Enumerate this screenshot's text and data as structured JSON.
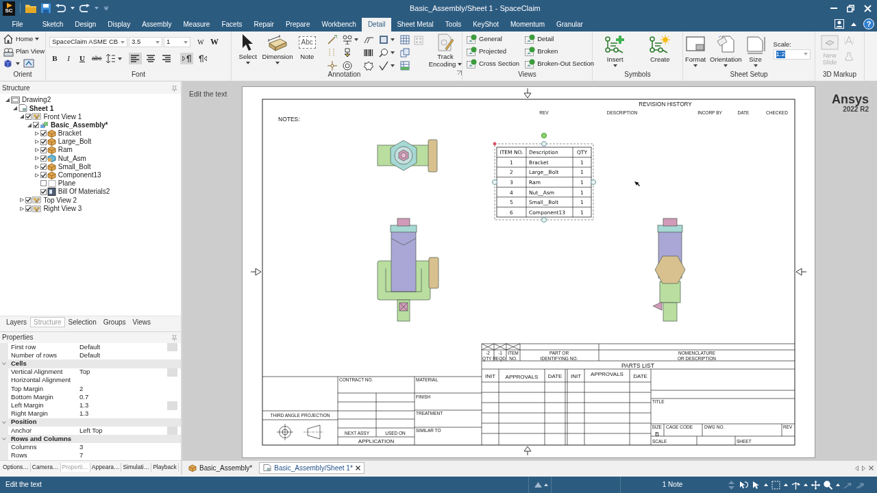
{
  "window": {
    "title": "Basic_Assembly/Sheet 1 - SpaceClaim",
    "logo_text": "SC"
  },
  "ribbon_tabs": [
    {
      "label": "File",
      "selected": false
    },
    {
      "label": "Sketch",
      "selected": false
    },
    {
      "label": "Design",
      "selected": false
    },
    {
      "label": "Display",
      "selected": false
    },
    {
      "label": "Assembly",
      "selected": false
    },
    {
      "label": "Measure",
      "selected": false
    },
    {
      "label": "Facets",
      "selected": false
    },
    {
      "label": "Repair",
      "selected": false
    },
    {
      "label": "Prepare",
      "selected": false
    },
    {
      "label": "Workbench",
      "selected": false
    },
    {
      "label": "Detail",
      "selected": true
    },
    {
      "label": "Sheet Metal",
      "selected": false
    },
    {
      "label": "Tools",
      "selected": false
    },
    {
      "label": "KeyShot",
      "selected": false
    },
    {
      "label": "Momentum",
      "selected": false
    },
    {
      "label": "Granular",
      "selected": false
    }
  ],
  "help_label": "?",
  "ribbon": {
    "orient": {
      "label": "Orient",
      "items": [
        {
          "kind": "home",
          "label": "Home"
        },
        {
          "kind": "plan",
          "label": "Plan View"
        }
      ]
    },
    "font": {
      "label": "Font",
      "font_name": "SpaceClaim ASME CB",
      "size": "3.5",
      "field_3": "1",
      "width_buttons": [
        {
          "kind": "normal",
          "label": "W"
        },
        {
          "kind": "bold",
          "label": "W"
        }
      ],
      "style_buttons": [
        {
          "kind": "bold",
          "label": "B"
        },
        {
          "kind": "italic",
          "label": "I"
        },
        {
          "kind": "underline",
          "label": "U"
        },
        {
          "kind": "strike",
          "label": "abc"
        }
      ],
      "align_buttons": [
        {
          "kind": "left",
          "selected": true
        },
        {
          "kind": "center",
          "selected": false
        },
        {
          "kind": "right",
          "selected": false
        }
      ],
      "direction_buttons": [
        {
          "kind": "ltr",
          "selected": true
        },
        {
          "kind": "rtl",
          "selected": false
        }
      ]
    },
    "annotation": {
      "label": "Annotation",
      "tools": [
        {
          "kind": "select",
          "label": "Select",
          "menu": true
        },
        {
          "kind": "dimension",
          "label": "Dimension",
          "menu": true
        },
        {
          "kind": "note",
          "label": "Note",
          "menu": false,
          "icon_text": "Abc"
        }
      ],
      "track": {
        "label_1": "Track",
        "label_2": "Encoding",
        "menu": true
      }
    },
    "views": {
      "label": "Views",
      "items": [
        {
          "label": "General"
        },
        {
          "label": "Projected"
        },
        {
          "label": "Cross Section"
        },
        {
          "label": "Detail"
        },
        {
          "label": "Broken"
        },
        {
          "label": "Broken-Out Section"
        }
      ]
    },
    "symbols": {
      "label": "Symbols",
      "items": [
        {
          "kind": "insert",
          "label": "Insert",
          "menu": true
        },
        {
          "kind": "create",
          "label": "Create",
          "menu": false
        }
      ]
    },
    "sheet_setup": {
      "label": "Sheet Setup",
      "items": [
        {
          "kind": "format",
          "label": "Format"
        },
        {
          "kind": "orientation",
          "label": "Orientation"
        },
        {
          "kind": "size",
          "label": "Size"
        }
      ],
      "scale": {
        "label": "Scale:",
        "value": "1:2",
        "selected": true
      }
    },
    "markup": {
      "label": "3D Markup",
      "items": [
        {
          "label_1": "New",
          "label_2": "Slide",
          "disabled": true
        }
      ]
    }
  },
  "structure": {
    "title": "Structure",
    "tree": [
      {
        "label": "Drawing2",
        "kind": "drawing",
        "expanded": true,
        "active": false,
        "children": [
          {
            "label": "Sheet 1",
            "kind": "sheet",
            "expanded": true,
            "active": true,
            "children": [
              {
                "label": "Front View 1",
                "kind": "view",
                "expanded": true,
                "checked": true,
                "active": false,
                "children": [
                  {
                    "label": "Basic_Assembly*",
                    "kind": "assembly",
                    "expanded": true,
                    "checked": true,
                    "active": true,
                    "children": [
                      {
                        "label": "Bracket",
                        "kind": "component",
                        "expanded": false,
                        "checked": true,
                        "active": false
                      },
                      {
                        "label": "Large_Bolt",
                        "kind": "component",
                        "expanded": false,
                        "checked": true,
                        "active": false
                      },
                      {
                        "label": "Ram",
                        "kind": "component",
                        "expanded": false,
                        "checked": true,
                        "active": false
                      },
                      {
                        "label": "Nut_Asm",
                        "kind": "subassembly",
                        "expanded": false,
                        "checked": true,
                        "active": false
                      },
                      {
                        "label": "Small_Bolt",
                        "kind": "component",
                        "expanded": false,
                        "checked": true,
                        "active": false
                      },
                      {
                        "label": "Component13",
                        "kind": "component",
                        "expanded": false,
                        "checked": true,
                        "active": false
                      },
                      {
                        "label": "Plane",
                        "kind": "plane",
                        "checked": false,
                        "active": false
                      },
                      {
                        "label": "Bill Of Materials2",
                        "kind": "table",
                        "checked": true,
                        "active": false
                      }
                    ]
                  }
                ]
              },
              {
                "label": "Top View 2",
                "kind": "view",
                "expanded": false,
                "checked": true,
                "active": false
              },
              {
                "label": "Right View 3",
                "kind": "view",
                "expanded": false,
                "checked": true,
                "active": false
              }
            ]
          }
        ]
      }
    ]
  },
  "panel_tabs": [
    {
      "label": "Layers",
      "selected": false
    },
    {
      "label": "Structure",
      "selected": true
    },
    {
      "label": "Selection",
      "selected": false
    },
    {
      "label": "Groups",
      "selected": false
    },
    {
      "label": "Views",
      "selected": false
    }
  ],
  "properties": {
    "title": "Properties",
    "rows": [
      {
        "kind": "row",
        "name": "First row",
        "value": "Default",
        "menu": true
      },
      {
        "kind": "row",
        "name": "Number of rows",
        "value": "Default",
        "menu": false
      },
      {
        "kind": "group",
        "name": "Cells",
        "expanded": true
      },
      {
        "kind": "row",
        "name": "Vertical Alignment",
        "value": "Top",
        "menu": true
      },
      {
        "kind": "row",
        "name": "Horizontal Alignment",
        "menu": false
      },
      {
        "kind": "row",
        "name": "Top Margin",
        "value": "2",
        "menu": false
      },
      {
        "kind": "row",
        "name": "Bottom Margin",
        "value": "0.7",
        "menu": false
      },
      {
        "kind": "row",
        "name": "Left Margin",
        "value": "1.3",
        "menu": true
      },
      {
        "kind": "row",
        "name": "Right Margin",
        "value": "1.3",
        "menu": false
      },
      {
        "kind": "group",
        "name": "Position",
        "expanded": true
      },
      {
        "kind": "row",
        "name": "Anchor",
        "value": "Left Top",
        "menu": true
      },
      {
        "kind": "group",
        "name": "Rows and Columns",
        "expanded": true
      },
      {
        "kind": "row",
        "name": "Columns",
        "value": "3",
        "menu": false
      },
      {
        "kind": "row",
        "name": "Rows",
        "value": "7",
        "menu": false
      }
    ]
  },
  "bottom_tabs": [
    {
      "label": "Options…",
      "selected": false
    },
    {
      "label": "Camera…",
      "selected": false
    },
    {
      "label": "Properti…",
      "selected": true
    },
    {
      "label": "Appeara…",
      "selected": false
    },
    {
      "label": "Simulati…",
      "selected": false
    },
    {
      "label": "Playback",
      "selected": false
    }
  ],
  "canvas": {
    "hint": "Edit the text",
    "brand": "Ansys",
    "version": "2022 R2"
  },
  "sheet": {
    "notes_label": "NOTES:",
    "revision_history": {
      "title": "REVISION HISTORY",
      "columns": [
        "REV",
        "DESCRIPTION",
        "INCORP BY",
        "DATE",
        "CHECKED"
      ]
    },
    "bom": {
      "selected": true,
      "columns": [
        "ITEM NO.",
        "Description",
        "QTY"
      ],
      "rows": [
        [
          "1",
          "Bracket",
          "1"
        ],
        [
          "2",
          "Large__Bolt",
          "1"
        ],
        [
          "3",
          "Ram",
          "1"
        ],
        [
          "4",
          "Nut__Asm",
          "1"
        ],
        [
          "5",
          "Small__Bolt",
          "1"
        ],
        [
          "6",
          "Component13",
          "1"
        ]
      ]
    },
    "parts_list": {
      "title": "PARTS LIST",
      "qty_cols": [
        "-2",
        "-1"
      ],
      "item_label": "ITEM",
      "qty_label": "QTY REQD",
      "no_label": "NO.",
      "part_label": [
        "PART OR",
        "IDENTIFYING NO."
      ],
      "nomenclature_label": [
        "NOMENCLATURE",
        "OR DESCRIPTION"
      ]
    },
    "title_block": {
      "approvals_header": [
        "INIT",
        "APPROVALS",
        "DATE",
        "INIT",
        "APPROVALS",
        "DATE"
      ],
      "contract_label": "CONTRACT NO.",
      "material_labels": [
        "MATERIAL",
        "FINISH",
        "TREATMENT",
        "SIMILAR TO"
      ],
      "projection_label": "THIRD ANGLE PROJECTION",
      "next_assy_label": "NEXT ASSY",
      "used_on_label": "USED ON",
      "application_label": "APPLICATION",
      "title_label": "TITLE",
      "size_label": "SIZE",
      "size": "B",
      "cage_code_label": "CAGE CODE",
      "dwg_no_label": "DWG NO.",
      "rev_label": "REV",
      "scale_label": "SCALE",
      "sheet_label": "SHEET"
    }
  },
  "document_tabs": [
    {
      "label": "Basic_Assembly*",
      "kind": "design",
      "selected": false,
      "closable": false
    },
    {
      "label": "Basic_Assembly/Sheet 1*",
      "kind": "drawing",
      "selected": true,
      "closable": true
    }
  ],
  "status_bar": {
    "message": "Edit the text",
    "selection": "1 Note"
  }
}
